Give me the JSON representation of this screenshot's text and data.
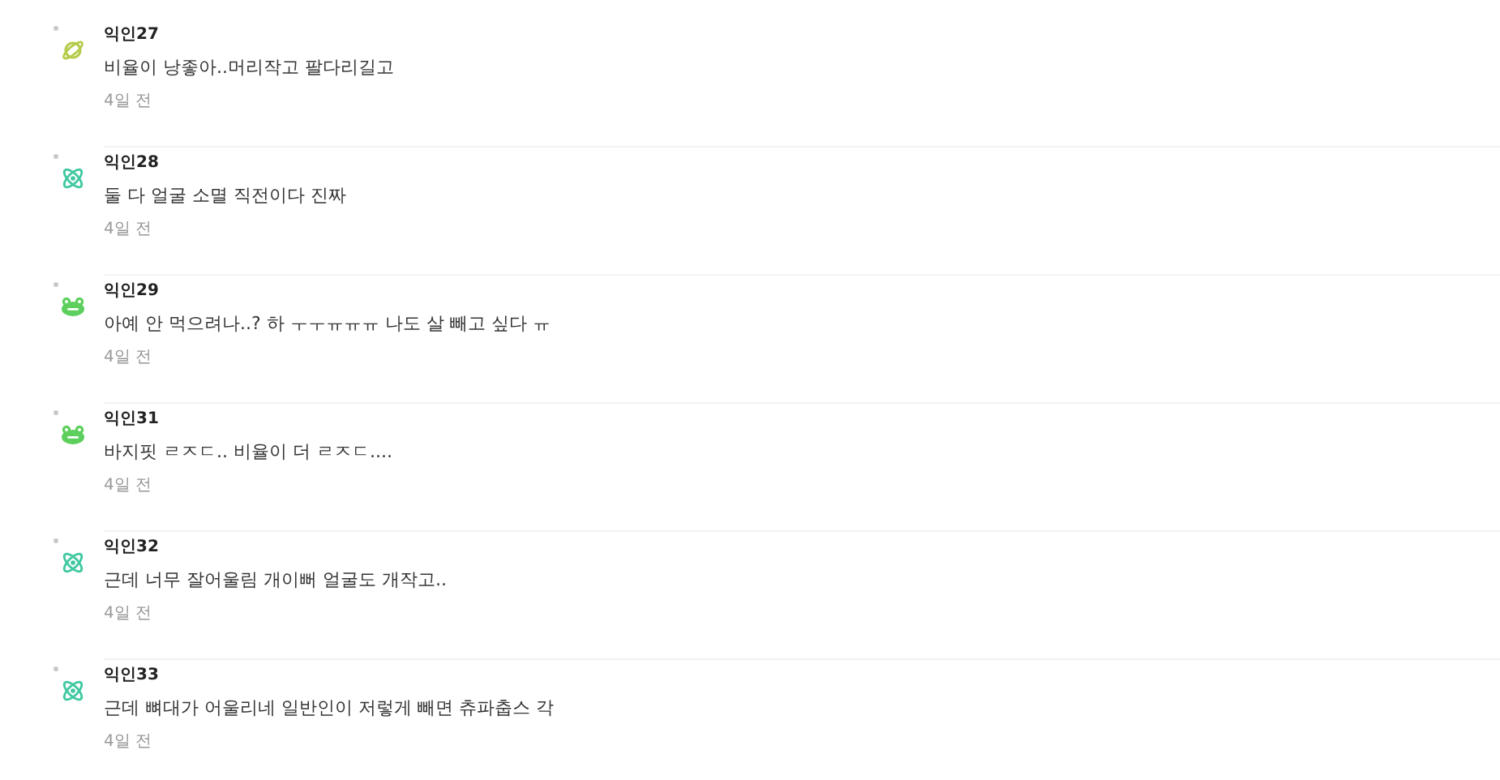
{
  "comments": [
    {
      "author": "익인27",
      "avatar": {
        "kind": "planet"
      },
      "text": "비율이 낭좋아..머리작고 팔다리길고",
      "time": "4일 전"
    },
    {
      "author": "익인28",
      "avatar": {
        "kind": "atom"
      },
      "text": "둘 다 얼굴 소멸 직전이다 진짜",
      "time": "4일 전"
    },
    {
      "author": "익인29",
      "avatar": {
        "kind": "frog"
      },
      "text": "아예 안 먹으려나..? 하 ㅜㅜㅠㅠㅠ 나도 살 빼고 싶다 ㅠ",
      "time": "4일 전"
    },
    {
      "author": "익인31",
      "avatar": {
        "kind": "frog"
      },
      "text": "바지핏 ㄹㅈㄷ.. 비율이 더 ㄹㅈㄷ....",
      "time": "4일 전"
    },
    {
      "author": "익인32",
      "avatar": {
        "kind": "atom"
      },
      "text": "근데 너무 잘어울림 개이뻐 얼굴도 개작고..",
      "time": "4일 전"
    },
    {
      "author": "익인33",
      "avatar": {
        "kind": "atom"
      },
      "text": "근데 뼈대가 어울리네 일반인이 저렇게 빼면 츄파춥스 각",
      "time": "4일 전"
    }
  ]
}
